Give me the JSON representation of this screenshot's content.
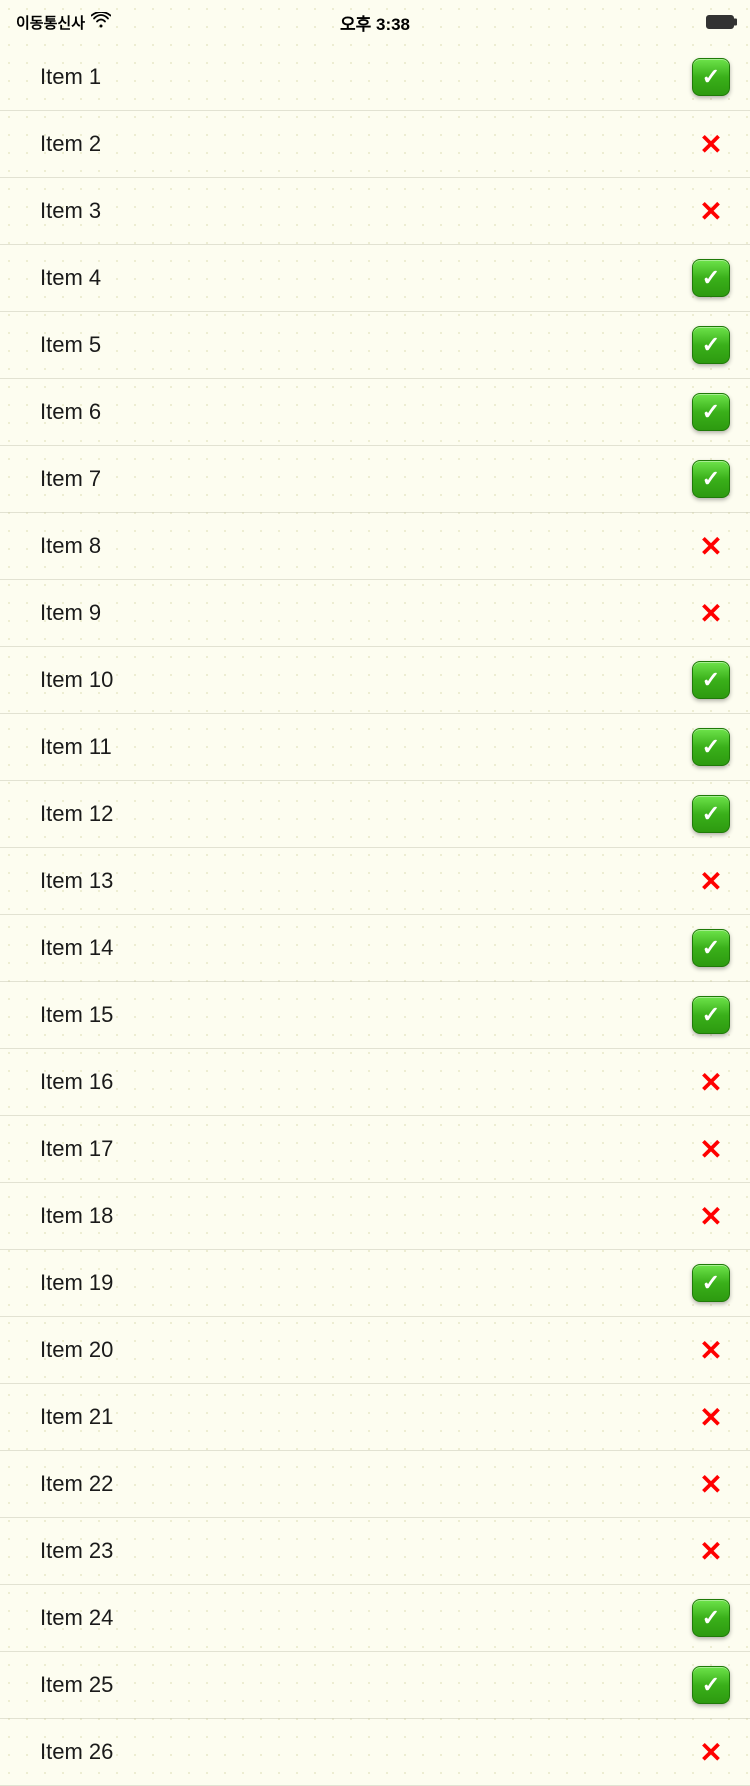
{
  "statusBar": {
    "carrier": "이동통신사",
    "time": "오후 3:38"
  },
  "items": [
    {
      "label": "Item 1",
      "checked": true
    },
    {
      "label": "Item 2",
      "checked": false
    },
    {
      "label": "Item 3",
      "checked": false
    },
    {
      "label": "Item 4",
      "checked": true
    },
    {
      "label": "Item 5",
      "checked": true
    },
    {
      "label": "Item 6",
      "checked": true
    },
    {
      "label": "Item 7",
      "checked": true
    },
    {
      "label": "Item 8",
      "checked": false
    },
    {
      "label": "Item 9",
      "checked": false
    },
    {
      "label": "Item 10",
      "checked": true
    },
    {
      "label": "Item 11",
      "checked": true
    },
    {
      "label": "Item 12",
      "checked": true
    },
    {
      "label": "Item 13",
      "checked": false
    },
    {
      "label": "Item 14",
      "checked": true
    },
    {
      "label": "Item 15",
      "checked": true
    },
    {
      "label": "Item 16",
      "checked": false
    },
    {
      "label": "Item 17",
      "checked": false
    },
    {
      "label": "Item 18",
      "checked": false
    },
    {
      "label": "Item 19",
      "checked": true
    },
    {
      "label": "Item 20",
      "checked": false
    },
    {
      "label": "Item 21",
      "checked": false
    },
    {
      "label": "Item 22",
      "checked": false
    },
    {
      "label": "Item 23",
      "checked": false
    },
    {
      "label": "Item 24",
      "checked": true
    },
    {
      "label": "Item 25",
      "checked": true
    },
    {
      "label": "Item 26",
      "checked": false
    }
  ]
}
